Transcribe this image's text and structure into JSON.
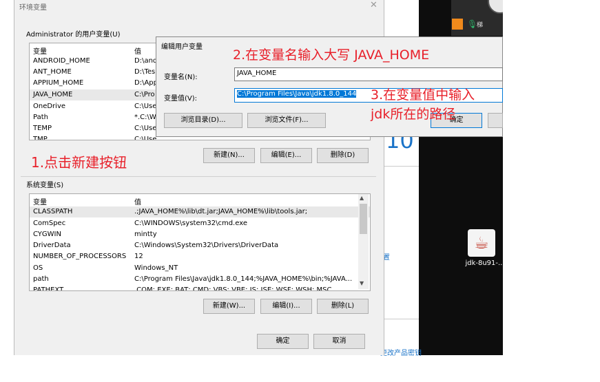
{
  "env_dialog": {
    "title": "环境变量",
    "close_glyph": "✕",
    "user_group_label": "Administrator 的用户变量(U)",
    "user_table": {
      "headers": [
        "变量",
        "值"
      ],
      "rows": [
        {
          "name": "ANDROID_HOME",
          "value": "D:\\and"
        },
        {
          "name": "ANT_HOME",
          "value": "D:\\Tes"
        },
        {
          "name": "APPIUM_HOME",
          "value": "D:\\App"
        },
        {
          "name": "JAVA_HOME",
          "value": "C:\\Pro"
        },
        {
          "name": "OneDrive",
          "value": "C:\\Use"
        },
        {
          "name": "Path",
          "value": "*.C:\\W"
        },
        {
          "name": "TEMP",
          "value": "C:\\Use"
        },
        {
          "name": "TMP",
          "value": "C:\\Use"
        }
      ]
    },
    "user_buttons": {
      "new": "新建(N)...",
      "edit": "编辑(E)...",
      "delete": "删除(D)"
    },
    "sys_group_label": "系统变量(S)",
    "sys_table": {
      "headers": [
        "变量",
        "值"
      ],
      "rows": [
        {
          "name": "CLASSPATH",
          "value": ".;JAVA_HOME%\\lib\\dt.jar;JAVA_HOME%\\lib\\tools.jar;"
        },
        {
          "name": "ComSpec",
          "value": "C:\\WINDOWS\\system32\\cmd.exe"
        },
        {
          "name": "CYGWIN",
          "value": "mintty"
        },
        {
          "name": "DriverData",
          "value": "C:\\Windows\\System32\\Drivers\\DriverData"
        },
        {
          "name": "NUMBER_OF_PROCESSORS",
          "value": "12"
        },
        {
          "name": "OS",
          "value": "Windows_NT"
        },
        {
          "name": "path",
          "value": "C:\\Program Files\\Java\\jdk1.8.0_144;%JAVA_HOME%\\bin;%JAVA..."
        },
        {
          "name": "PATHEXT",
          "value": ".COM;.EXE;.BAT;.CMD;.VBS;.VBE;.JS;.JSE;.WSF;.WSH;.MSC"
        }
      ]
    },
    "sys_buttons": {
      "new": "新建(W)...",
      "edit": "编辑(I)...",
      "delete": "删除(L)"
    },
    "ok": "确定",
    "cancel": "取消"
  },
  "edit_dialog": {
    "title": "编辑用户变量",
    "name_label": "变量名(N):",
    "name_value": "JAVA_HOME",
    "value_label": "变量值(V):",
    "value_value": "C:\\Program Files\\Java\\jdk1.8.0_144",
    "browse_dir": "浏览目录(D)...",
    "browse_file": "浏览文件(F)...",
    "ok": "确定"
  },
  "annotations": {
    "step1": "1.点击新建按钮",
    "step2": "2.在变量名输入大写 JAVA_HOME",
    "step3_line1": "3.在变量值中输入",
    "step3_line2": "jdk所在的路径"
  },
  "background": {
    "big_number": "10",
    "link1": "置",
    "link2": "更改产品密钥"
  },
  "desktop": {
    "java_icon_label": "jdk-8u91-...",
    "tray_label": "梯"
  },
  "colors": {
    "annotation": "#e8202a",
    "selection": "#0078d7",
    "link": "#1a73c8"
  }
}
